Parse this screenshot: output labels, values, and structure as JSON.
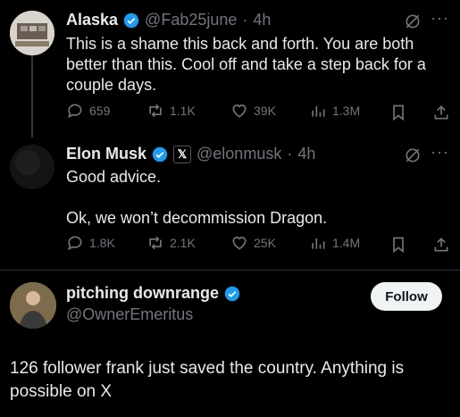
{
  "tweets": [
    {
      "name": "Alaska",
      "handle": "@Fab25june",
      "time": "4h",
      "text": "This is a shame this back and forth. You are both better than this. Cool off and take a step back for a couple days.",
      "replies": "659",
      "reposts": "1.1K",
      "likes": "39K",
      "views": "1.3M"
    },
    {
      "name": "Elon Musk",
      "handle": "@elonmusk",
      "time": "4h",
      "text_line1": "Good advice.",
      "text_line2": "Ok, we won’t decommission Dragon.",
      "replies": "1.8K",
      "reposts": "2.1K",
      "likes": "25K",
      "views": "1.4M"
    }
  ],
  "quote": {
    "name": "pitching downrange",
    "handle": "@OwnerEmeritus",
    "follow_label": "Follow",
    "text": "126 follower frank just saved the country. Anything is possible on X"
  },
  "colors": {
    "verified": "#1d9bf0",
    "background": "#000000",
    "secondary_text": "#71767b"
  },
  "icons": [
    "reply-icon",
    "repost-icon",
    "like-icon",
    "views-icon",
    "bookmark-icon",
    "share-icon",
    "grok-icon",
    "more-icon",
    "verified-icon",
    "x-affiliate-icon"
  ]
}
